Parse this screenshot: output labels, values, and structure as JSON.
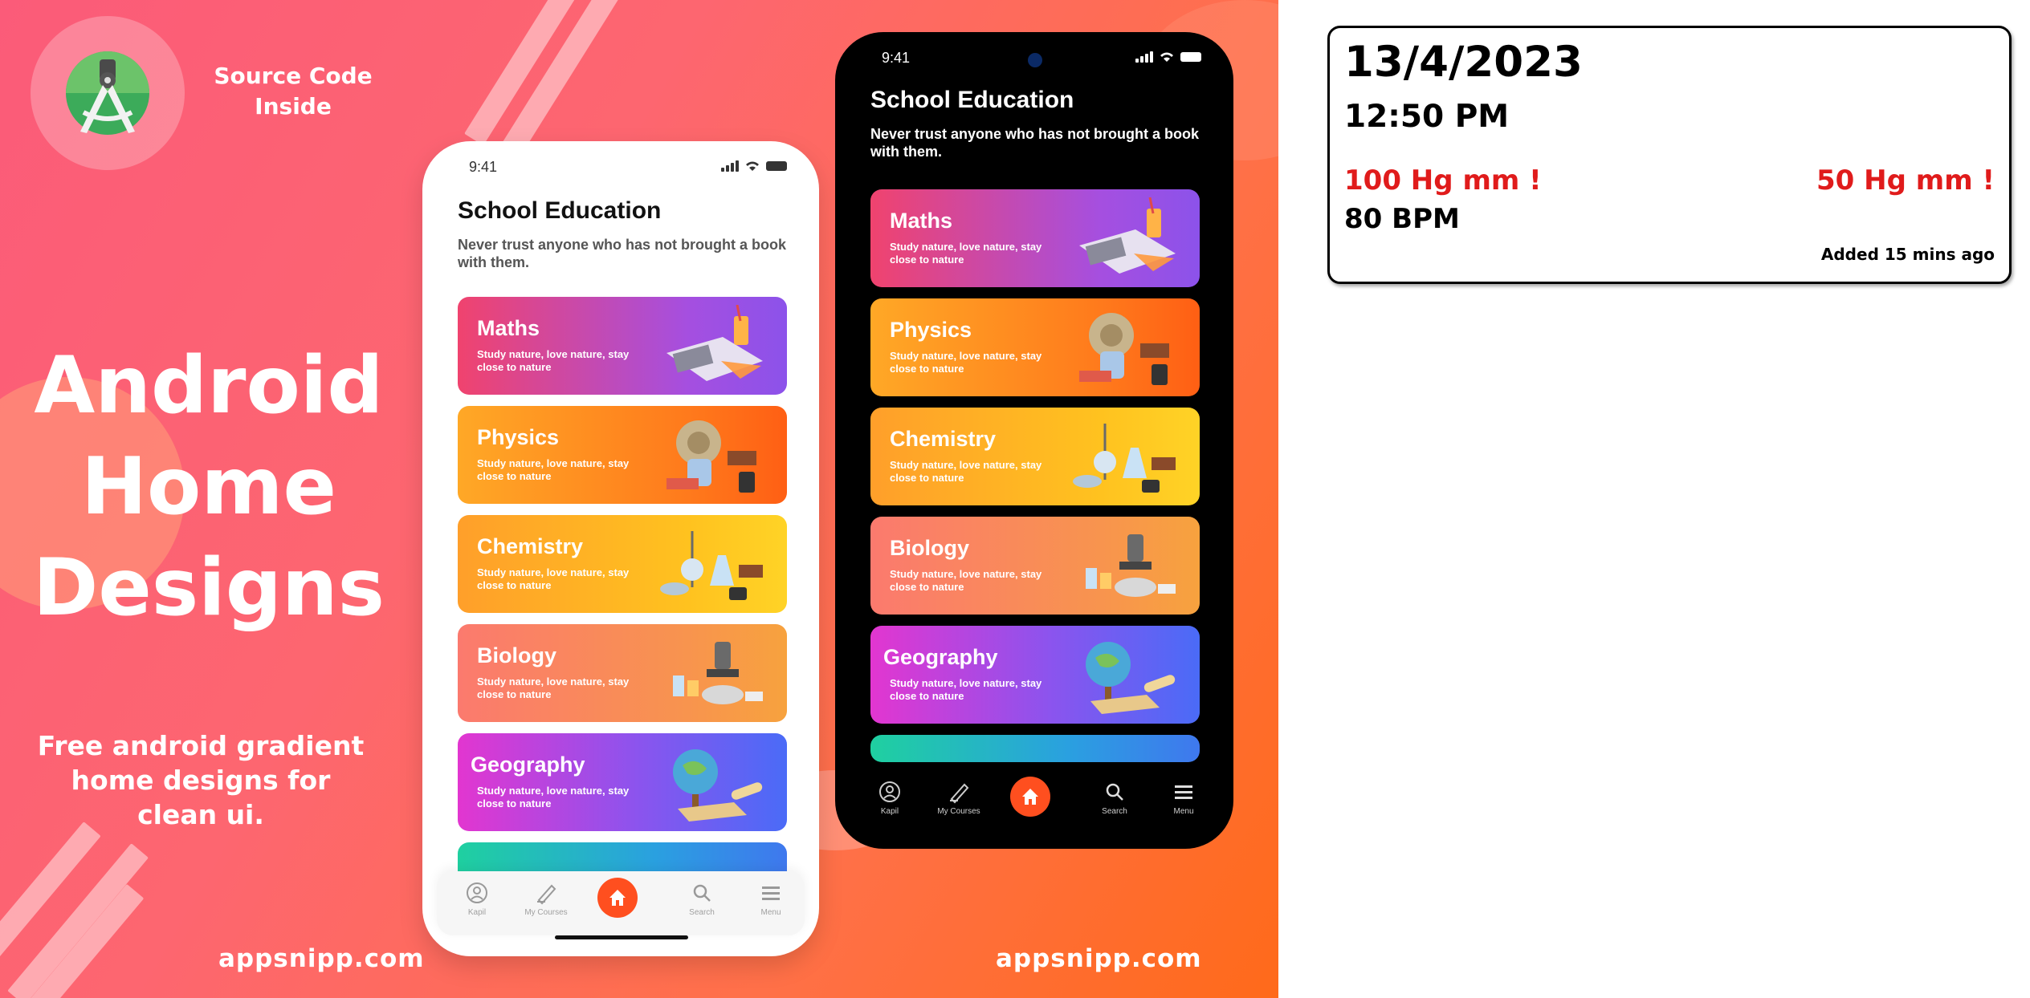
{
  "banner": {
    "source_label": "Source Code Inside",
    "title_lines": [
      "Android",
      "Home",
      "Designs"
    ],
    "subtitle": "Free android gradient home designs for clean ui.",
    "website_left": "appsnipp.com",
    "website_right": "appsnipp.com",
    "logo_icon": "android-studio-icon",
    "colors": {
      "gradient_start": "#fb5b79",
      "gradient_end": "#ff6a1a"
    }
  },
  "app": {
    "status_time": "9:41",
    "title": "School Education",
    "subtitle": "Never trust anyone who has not brought a book with them.",
    "cards": [
      {
        "title": "Maths",
        "desc": "Study nature, love nature, stay close to nature",
        "icon": "maths-illustration"
      },
      {
        "title": "Physics",
        "desc": "Study nature, love nature, stay close to nature",
        "icon": "physics-illustration"
      },
      {
        "title": "Chemistry",
        "desc": "Study nature, love nature, stay close to nature",
        "icon": "chemistry-illustration"
      },
      {
        "title": "Biology",
        "desc": "Study nature, love nature, stay close to nature",
        "icon": "biology-illustration"
      },
      {
        "title": "Geography",
        "desc": "Study nature, love nature, stay close to nature",
        "icon": "geography-illustration"
      }
    ],
    "nav": {
      "profile": "Kapil",
      "courses": "My Courses",
      "search": "Search",
      "menu": "Menu"
    },
    "accent": "#ff4f1f"
  },
  "reading": {
    "date": "13/4/2023",
    "time": "12:50 PM",
    "systolic": "100 Hg mm !",
    "diastolic": "50 Hg mm !",
    "pulse": "80 BPM",
    "added": "Added 15 mins ago",
    "alert_color": "#e01b1b"
  }
}
